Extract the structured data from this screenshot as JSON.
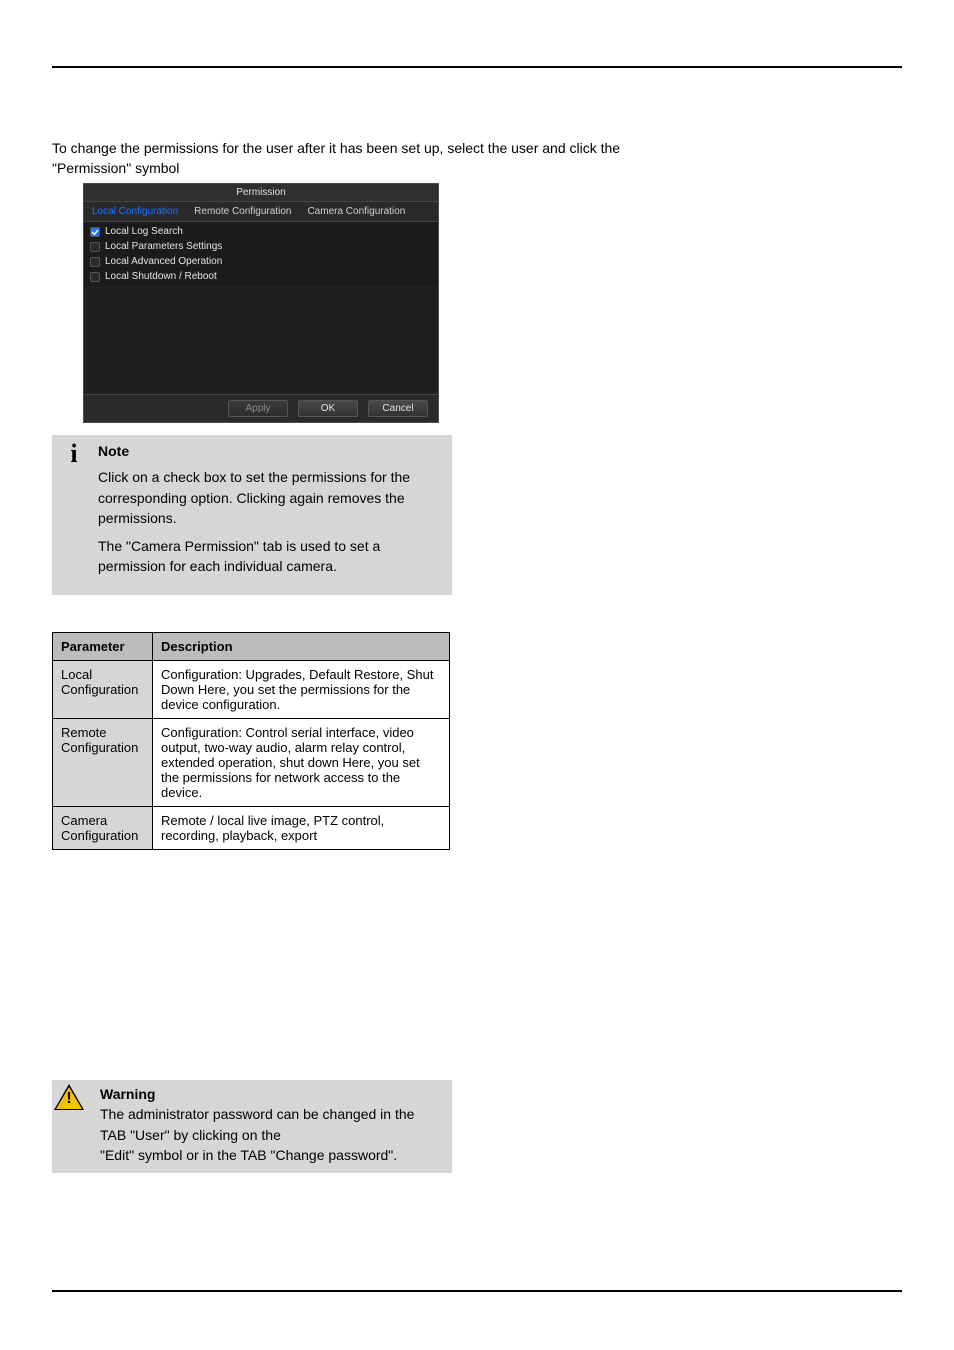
{
  "intro": {
    "line1": "To change the permissions for the user after it has been set up, select the user and click the",
    "line2": "\"Permission\" symbol"
  },
  "dialog": {
    "title": "Permission",
    "tabs": [
      "Local Configuration",
      "Remote Configuration",
      "Camera Configuration"
    ],
    "active_tab_index": 0,
    "items": [
      {
        "label": "Local Log Search",
        "checked": true
      },
      {
        "label": "Local Parameters Settings",
        "checked": false
      },
      {
        "label": "Local Advanced Operation",
        "checked": false
      },
      {
        "label": "Local Shutdown / Reboot",
        "checked": false
      }
    ],
    "buttons": {
      "apply": "Apply",
      "ok": "OK",
      "cancel": "Cancel"
    }
  },
  "info_box": {
    "p1": "Click on a check box to set the permissions for the corresponding option. Clicking again removes the permissions.",
    "p2_a": "The \"Camera Permission\" tab is used to set a",
    "p2_b": "permission for each individual camera."
  },
  "perm_table": {
    "headers": [
      "Parameter",
      "Description"
    ],
    "rows": [
      {
        "c1": "Local Configuration",
        "c2": "Configuration: Upgrades, Default Restore, Shut Down Here, you set the permissions for the device configuration."
      },
      {
        "c1": "Remote Configuration",
        "c2": "Configuration: Control serial interface, video output, two-way audio, alarm relay control, extended operation, shut down Here, you set the permissions for network access to the device."
      },
      {
        "c1": "Camera Configuration",
        "c2": "Remote / local live image, PTZ control, recording, playback, export"
      }
    ]
  },
  "warn_box": {
    "line1": "The administrator password can be changed in the TAB \"User\" by clicking on the",
    "line2": "\"Edit\" symbol or in the TAB \"Change password\"."
  }
}
